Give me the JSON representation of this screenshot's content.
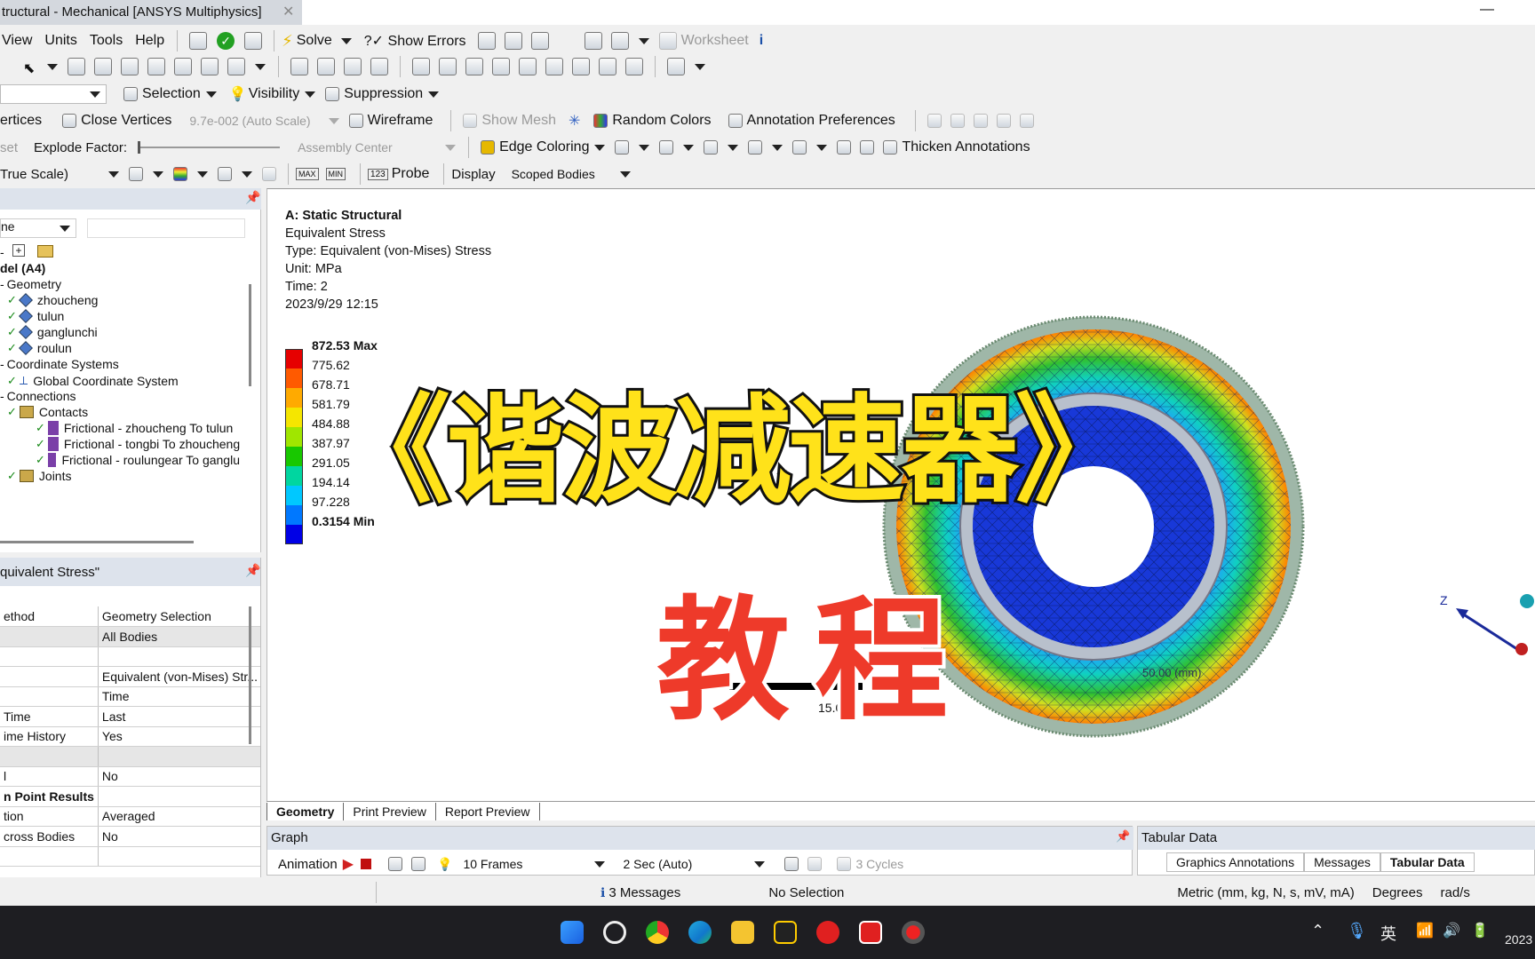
{
  "window": {
    "title": "tructural - Mechanical [ANSYS Multiphysics]",
    "minimize": "—"
  },
  "menu": {
    "items": [
      "View",
      "Units",
      "Tools",
      "Help"
    ],
    "solve": "Solve",
    "show_errors": "?✓ Show Errors",
    "worksheet": "Worksheet"
  },
  "toolbar3": {
    "selection": "Selection",
    "visibility": "Visibility",
    "suppression": "Suppression"
  },
  "toolbar4": {
    "vertices": "ertices",
    "close_vertices": "Close Vertices",
    "scale": "9.7e-002 (Auto Scale)",
    "wireframe": "Wireframe",
    "show_mesh": "Show Mesh",
    "random_colors": "Random Colors",
    "annotation_prefs": "Annotation Preferences"
  },
  "toolbar5": {
    "set": "set",
    "explode": "Explode Factor:",
    "assembly": "Assembly Center",
    "edge_coloring": "Edge Coloring",
    "thicken": "Thicken Annotations"
  },
  "toolbar6": {
    "scale": "True Scale)",
    "probe": "Probe",
    "display": "Display",
    "scoped": "Scoped Bodies",
    "max": "MAX",
    "min": "MIN"
  },
  "outline": {
    "filter": "ne",
    "items": [
      "del (A4)",
      "Geometry",
      "zhoucheng",
      "tulun",
      "ganglunchi",
      "roulun",
      "Coordinate Systems",
      "Global Coordinate System",
      "Connections",
      "Contacts",
      "Frictional - zhoucheng To tulun",
      "Frictional - tongbi To zhoucheng",
      "Frictional - roulungear To ganglu",
      "Joints"
    ]
  },
  "details": {
    "title": "quivalent Stress\"",
    "rows": [
      [
        "ethod",
        "Geometry Selection"
      ],
      [
        "",
        "All Bodies"
      ],
      [
        "",
        ""
      ],
      [
        "",
        "Equivalent (von-Mises) Str..."
      ],
      [
        "",
        "Time"
      ],
      [
        "Time",
        "Last"
      ],
      [
        "ime History",
        "Yes"
      ],
      [
        "",
        ""
      ],
      [
        "l",
        "No"
      ],
      [
        "n Point Results",
        ""
      ],
      [
        "tion",
        "Averaged"
      ],
      [
        "cross Bodies",
        "No"
      ],
      [
        "",
        ""
      ]
    ]
  },
  "viewport": {
    "header": "A: Static Structural",
    "lines": [
      "Equivalent Stress",
      "Type: Equivalent (von-Mises) Stress",
      "Unit: MPa",
      "Time: 2",
      "2023/9/29 12:15"
    ],
    "scale_label": "15.00",
    "scale_bar": "50.00 (mm)"
  },
  "legend": {
    "values": [
      "872.53 Max",
      "775.62",
      "678.71",
      "581.79",
      "484.88",
      "387.97",
      "291.05",
      "194.14",
      "97.228",
      "0.3154 Min"
    ],
    "colors": [
      "#e60000",
      "#ff5a00",
      "#ffaa00",
      "#f5e600",
      "#a0e600",
      "#18c800",
      "#00d6a0",
      "#00c8ff",
      "#0078ff",
      "#0000e6"
    ]
  },
  "overlay": {
    "title": "《谐波减速器》",
    "subtitle": "教程"
  },
  "tabs": {
    "geometry": "Geometry",
    "print": "Print Preview",
    "report": "Report Preview"
  },
  "graph": {
    "title": "Graph",
    "animation": "Animation",
    "frames": "10 Frames",
    "sec": "2 Sec (Auto)",
    "cycles": "3 Cycles"
  },
  "tabular": {
    "title": "Tabular Data",
    "tabs": [
      "Graphics Annotations",
      "Messages",
      "Tabular Data"
    ]
  },
  "status": {
    "messages": "3 Messages",
    "selection": "No Selection",
    "units": "Metric (mm, kg, N, s, mV, mA)",
    "degrees": "Degrees",
    "rads": "rad/s"
  },
  "taskbar": {
    "ime": "英",
    "year": "2023",
    "icons": [
      "windows-start-icon",
      "search-icon",
      "chrome-icon",
      "edge-icon",
      "folder-icon",
      "ansys-icon",
      "netease-music-icon",
      "mail-icon",
      "record-icon"
    ]
  }
}
